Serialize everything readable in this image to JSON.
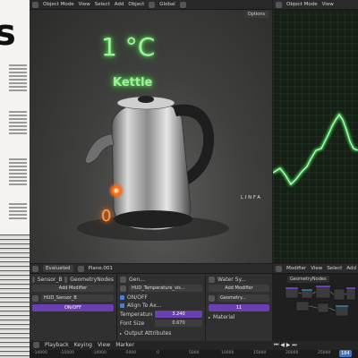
{
  "doc": {
    "big_text": "s"
  },
  "viewport": {
    "header": [
      "Object Mode",
      "View",
      "Select",
      "Add",
      "Object",
      "Global"
    ],
    "options_label": "Options",
    "hud_temperature": "1 °C",
    "hud_label": "Kettle",
    "hud_zero": "0",
    "brand_text": "LINFA"
  },
  "graph_panel": {
    "header": [
      "Object Mode",
      "View"
    ]
  },
  "props_bar": {
    "mode": "Evaluated",
    "object": "Plane.001"
  },
  "panels": [
    {
      "tab": "Sensor_B",
      "tree": "GeometryNodes",
      "add": "Add Modifier",
      "mod": "HUD_Sensor_B",
      "toggle": "ON/OFF"
    },
    {
      "tab": "Gen...",
      "mod": "HUD_Temperature_vis...",
      "toggle": "ON/OFF",
      "align": "Align To Ax...",
      "temp_label": "Temperature...",
      "temp_value": "3.240",
      "font_label": "Font Size",
      "font_value": "0.670",
      "outputs": "Output Attributes"
    },
    {
      "tab": "Water Sy...",
      "add": "Add Modifier",
      "mod": "Geometry...",
      "count": "11",
      "extra": "Material"
    }
  ],
  "node_panel": {
    "header": [
      "Modifier",
      "View",
      "Select",
      "Add"
    ],
    "tree": "GeometryNodes"
  },
  "timeline": {
    "menu": [
      "Playback",
      "Keying",
      "View",
      "Marker"
    ],
    "ticks": [
      "-14000",
      "-15000",
      "-10000",
      "-5000",
      "0",
      "5000",
      "10000",
      "15000",
      "20000",
      "25000"
    ],
    "current_frame": "184"
  },
  "colors": {
    "glow_green": "#9cf59a",
    "glow_orange": "#ff9d4a",
    "accent_purple": "#6a3fb1"
  }
}
